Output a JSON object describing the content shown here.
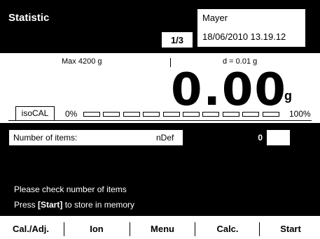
{
  "header": {
    "title": "Statistic",
    "page_indicator": "1/3",
    "user": "Mayer",
    "datetime": "18/06/2010 13.19.12"
  },
  "weighing": {
    "max_label": "Max 4200 g",
    "d_label": "d = 0.01 g",
    "value": "0.00",
    "unit": "g",
    "isocal_label": "isoCAL",
    "bar_min": "0%",
    "bar_max": "100%",
    "bar_fill_fraction": 0
  },
  "statistic": {
    "items_label": "Number of items:",
    "items_code": "nDef",
    "items_value": "0",
    "message_1": "Please check number of items",
    "message_2_prefix": "Press ",
    "message_2_key": "[Start]",
    "message_2_suffix": " to store in memory"
  },
  "softkeys": [
    "Cal./Adj.",
    "Ion",
    "Menu",
    "Calc.",
    "Start"
  ]
}
